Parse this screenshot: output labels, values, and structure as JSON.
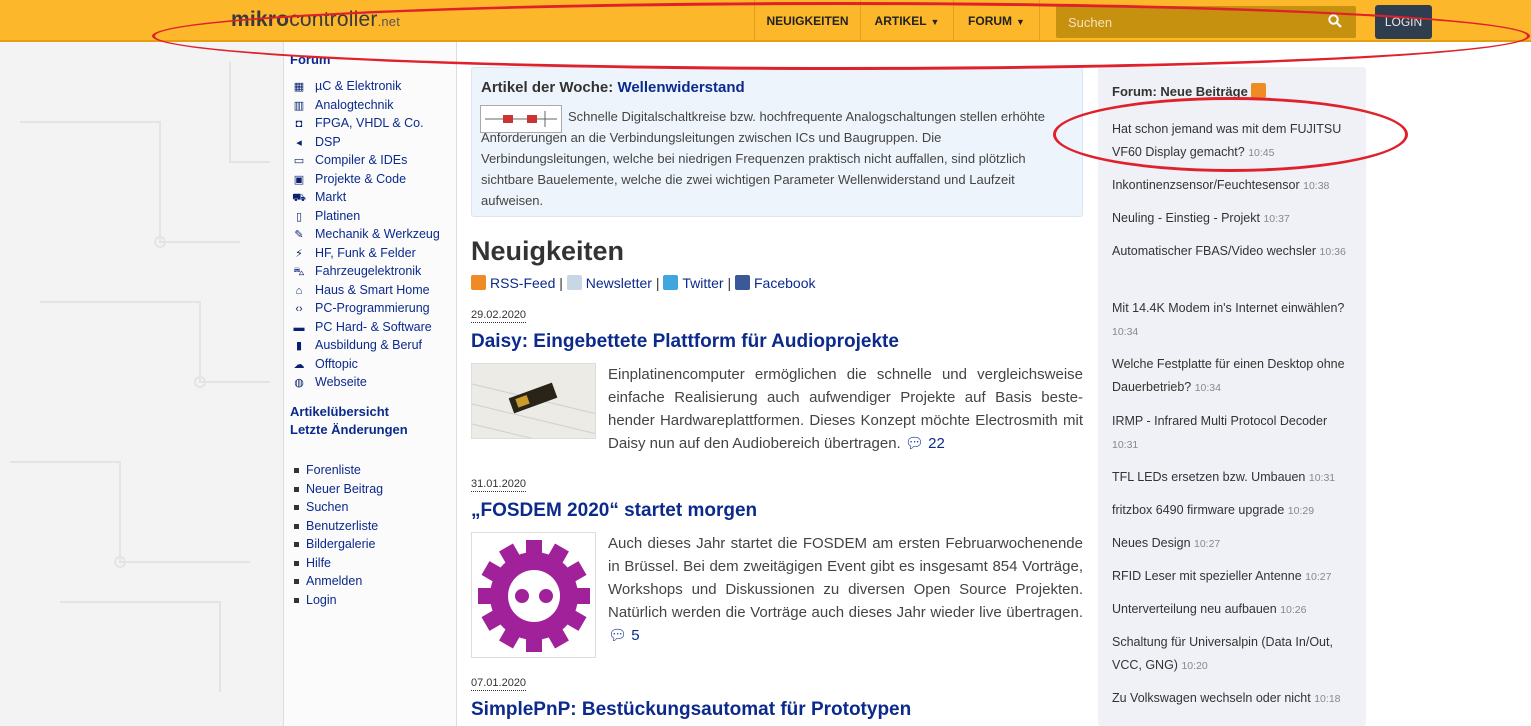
{
  "header": {
    "logo_bold": "mikro",
    "logo_rest": "controller",
    "logo_tld": ".net",
    "nav": [
      "NEUIGKEITEN",
      "ARTIKEL",
      "FORUM"
    ],
    "search_placeholder": "Suchen",
    "login_label": "LOGIN",
    "accent": "#fdb72a"
  },
  "sidebar": {
    "forum_heading": "Forum",
    "forum_items": [
      {
        "label": "µC & Elektronik",
        "icon": "chip-icon"
      },
      {
        "label": "Analogtechnik",
        "icon": "analog-icon"
      },
      {
        "label": "FPGA, VHDL & Co.",
        "icon": "fpga-icon"
      },
      {
        "label": "DSP",
        "icon": "dsp-icon"
      },
      {
        "label": "Compiler & IDEs",
        "icon": "compiler-icon"
      },
      {
        "label": "Projekte & Code",
        "icon": "projects-icon"
      },
      {
        "label": "Markt",
        "icon": "cart-icon"
      },
      {
        "label": "Platinen",
        "icon": "board-icon"
      },
      {
        "label": "Mechanik & Werkzeug",
        "icon": "wrench-icon"
      },
      {
        "label": "HF, Funk & Felder",
        "icon": "antenna-icon"
      },
      {
        "label": "Fahrzeugelektronik",
        "icon": "car-icon"
      },
      {
        "label": "Haus & Smart Home",
        "icon": "home-icon"
      },
      {
        "label": "PC-Programmierung",
        "icon": "code-icon"
      },
      {
        "label": "PC Hard- & Software",
        "icon": "laptop-icon"
      },
      {
        "label": "Ausbildung & Beruf",
        "icon": "book-icon"
      },
      {
        "label": "Offtopic",
        "icon": "chat-icon"
      },
      {
        "label": "Webseite",
        "icon": "globe-icon"
      }
    ],
    "article_links": [
      "Artikelübersicht",
      "Letzte Änderungen"
    ],
    "user_links": [
      "Forenliste",
      "Neuer Beitrag",
      "Suchen",
      "Benutzerliste",
      "Bildergalerie",
      "Hilfe",
      "Anmelden",
      "Login"
    ]
  },
  "featured": {
    "label": "Artikel der Woche:",
    "link": "Wellenwiderstand",
    "text": "Schnelle Digitalschaltkreise bzw. hochfrequente Analogschaltungen stellen erhöhte Anforderungen an die Verbindungsleitungen zwischen ICs und Baugruppen. Die Verbindungsleitungen, welche bei niedrigen Frequenzen praktisch nicht auffallen, sind plötzlich sichtbare Bauelemente, welche die zwei wichtigen Parameter Wellenwiderstand und Laufzeit aufweisen."
  },
  "news": {
    "heading": "Neuigkeiten",
    "feeds": [
      "RSS-Feed",
      "Newsletter",
      "Twitter",
      "Facebook"
    ],
    "separator": "|",
    "articles": [
      {
        "date": "29.02.2020",
        "title": "Daisy: Eingebettete Plattform für Audioprojekte",
        "text": "Einplatinencomputer ermöglichen die schnelle und vergleichsweise einfache Realisierung auch aufwendiger Projekte auf Basis beste­hender Hardwareplattformen. Dieses Konzept möchte Electrosmith mit Daisy nun auf den Audiobereich übertragen.",
        "comments": "22"
      },
      {
        "date": "31.01.2020",
        "title": "„FOSDEM 2020“ startet morgen",
        "text": "Auch dieses Jahr startet die FOSDEM am ersten Februarwochenen­de in Brüssel. Bei dem zweitägigen Event gibt es insgesamt 854 Vorträge, Workshops und Diskussionen zu diversen Open Source Projekten. Natürlich werden die Vorträge auch dieses Jahr wieder live übertragen.",
        "comments": "5"
      },
      {
        "date": "07.01.2020",
        "title": "SimplePnP: Bestückungsautomat für Prototypen"
      }
    ]
  },
  "forum_posts": {
    "heading": "Forum: Neue Beiträge",
    "posts": [
      {
        "title": "Hat schon jemand was mit dem FUJITSU VF60 Display gemacht?",
        "time": "10:45"
      },
      {
        "title": "Inkontinenzsensor/Feuchtesensor",
        "time": "10:38"
      },
      {
        "title": "Neuling - Einstieg - Projekt",
        "time": "10:37"
      },
      {
        "title": "Automatischer FBAS/Video wechsler",
        "time": "10:36"
      },
      {
        "title": "Mit 14.4K Modem in's Internet einwählen?",
        "time": "10:34"
      },
      {
        "title": "Welche Festplatte für einen Desktop ohne Dauerbetrieb?",
        "time": "10:34"
      },
      {
        "title": "IRMP - Infrared Multi Protocol Decoder",
        "time": "10:31"
      },
      {
        "title": "TFL LEDs ersetzen bzw. Umbauen",
        "time": "10:31"
      },
      {
        "title": "fritzbox 6490 firmware upgrade",
        "time": "10:29"
      },
      {
        "title": "Neues Design",
        "time": "10:27"
      },
      {
        "title": "RFID Leser mit spezieller Antenne",
        "time": "10:27"
      },
      {
        "title": "Unterverteilung neu aufbauen",
        "time": "10:26"
      },
      {
        "title": "Schaltung für Universalpin (Data In/Out, VCC, GNG)",
        "time": "10:20"
      },
      {
        "title": "Zu Volkswagen wechseln oder nicht",
        "time": "10:18"
      }
    ]
  },
  "annotation_color": "#e0202a"
}
